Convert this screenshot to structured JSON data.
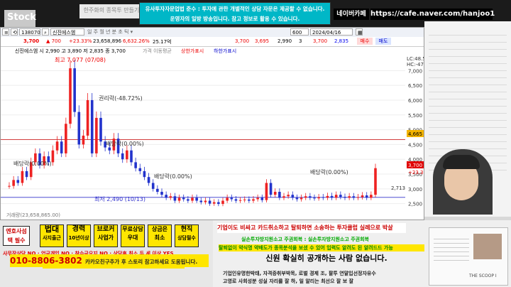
{
  "top": {
    "stock_logo": "Stock",
    "tab_bg": "한주화의 종목투 만들기",
    "disclaimer_line1": "유사투자자문업법 준수 : 투자에 관한 개별적인 상담 자문은 제공할 수 없습니다.",
    "disclaimer_line2": "운영자의 일방 방송입니다. 참고 정보로 활용 수 있습니다.",
    "cafe_label": "네이버카페",
    "cafe_url": "https://cafe.naver.com/hanjoo1"
  },
  "toolbar": {
    "code": "138070",
    "name": "신진에스엠",
    "date": "2024/04/16",
    "count": "600",
    "num_600": "600",
    "btn_buy": "매수",
    "btn_sell": "매도"
  },
  "quote": {
    "price": "3,700",
    "change": "▲ 700",
    "rate": "+23.33%",
    "volume": "23,658,896",
    "vol_rate": "6,632.26%",
    "amount": "25.17억",
    "open": "2,990",
    "high": "3,890",
    "low": "2,835",
    "close_label": "일봉",
    "extra": "3,700",
    "extra2": "3,695",
    "extra3": "2,990",
    "extra4": "3",
    "extra5": "3,700",
    "extra6": "2,835"
  },
  "info": {
    "text": "신진에스엠 시 2,990 고 3,890 저 2,835 종 3,700",
    "legend1": "가격 이동평균",
    "legend2": "상한가표시",
    "legend3": "하한가표시",
    "bottom_label": "거래량(23,658,865.00)"
  },
  "chart_data": {
    "type": "candlestick",
    "annotations": {
      "high": "최고 7,077 (07/08)",
      "drop1": "권리락(-48.72%)",
      "mid": "배당락(0.00%)",
      "left": "배당락(0.00%)",
      "mid2": "배당락(0.00%)",
      "right": "배당락(0.00%)",
      "low": "최저 2,490 (10/13)"
    },
    "y_ticks": [
      "7,000",
      "6,500",
      "6,000",
      "5,500",
      "5,000",
      "4,500",
      "4,000",
      "3,500",
      "3,000",
      "2,500"
    ],
    "y_label_top": "LC:48.59",
    "y_label_top2": "HC:-47.72",
    "price_label_mid": "4,665",
    "price_label_cur": "3,700",
    "price_label_cur_rate": "+23.33%",
    "price_label_low": "2,713",
    "reference_line": 4665,
    "ylim": [
      2300,
      7200
    ],
    "close_series": [
      3100,
      3300,
      3200,
      3600,
      3400,
      3900,
      4200,
      3800,
      4100,
      3900,
      4300,
      4600,
      4200,
      5200,
      7077,
      5600,
      4500,
      4800,
      6000,
      4200,
      5400,
      4600,
      4400,
      4300,
      4700,
      4200,
      4000,
      4300,
      3900,
      3700,
      3600,
      3400,
      3200,
      3000,
      2900,
      2800,
      2700,
      2750,
      2600,
      2700,
      2650,
      2600,
      2700,
      2600,
      2550,
      2600,
      2500,
      2550,
      2490,
      2600,
      2700,
      2650,
      2600,
      2620,
      2640,
      2600,
      2650,
      2700,
      2620,
      3200,
      2800,
      2900,
      2700,
      2750,
      2800,
      2700,
      2650,
      2700,
      2750,
      2700,
      2680,
      2720,
      2700,
      2760,
      2700,
      2800,
      2730,
      2700,
      2750,
      2700,
      2720,
      2780,
      2700,
      2800,
      3700
    ]
  },
  "bottom": {
    "box1": "엔호사섬택 필수",
    "box2": "법대",
    "box2b": "사지출근",
    "box3": "경력",
    "box3b": "10년이상",
    "box4": "브로커",
    "box4b": "사업가",
    "box5": "무료상담",
    "box5b": "우대",
    "box6": "상금은",
    "box6b": "최소",
    "box7": "현직",
    "box7b": "상담필수",
    "red_line1": "사무장상담 NO · 업금개입 NO · 착수금요지 NO · 상담후 최소 두 세 이상 YES",
    "yellow_line": "법대출신 + 사법시험출신 + 경력10년이상",
    "phone": "010-8806-3802",
    "phone_tail": "카카오친구추가 후 스토리 참고하세요 도움됩니다.",
    "banner_top": "기업이도 비싸고 카드취소하고 탈퇴하면 소송하는 투자클럽 실례으로 박살",
    "banner_sub": "실손투자방지원소고 주권회복 : 실손투자방지원소고 주권회복",
    "banner_green": "탈퇴없이 약식명 약배도가 종목분석을 보셨 수 있어 입력도 알려도 된 알려드드 가능",
    "banner_main": "신원 확실히 공개하는 사람 없습니다.",
    "banner_foot1": "기업인유명한박태, 자격증취부박목, 로벌 경제 조, 팔투 연말입선정자유수",
    "banner_foot2": "고영로 사회성분 성실 자리를 잘 하, 일 알리는 최선으 잘 보 잘",
    "pip_title": "THE SCOOP I"
  }
}
